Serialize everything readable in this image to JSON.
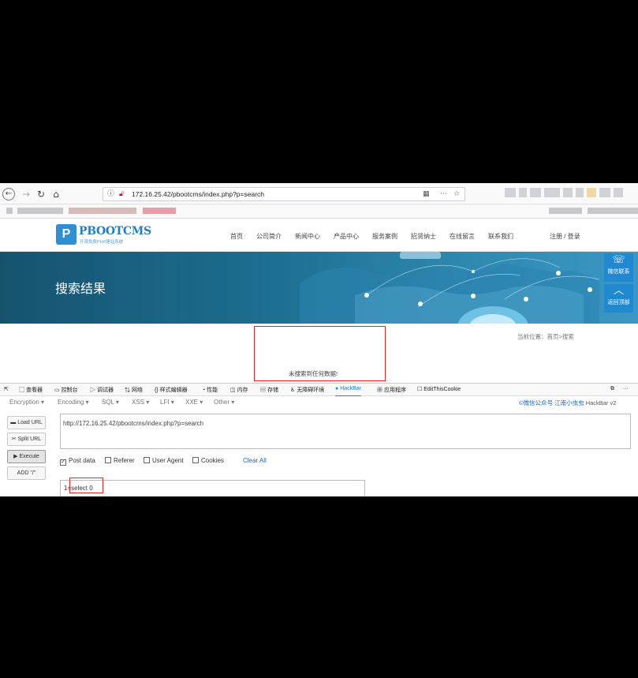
{
  "browser": {
    "url": "172.16.25.42/pbootcms/index.php?p=search",
    "nav_icons": [
      "back-icon",
      "forward-icon",
      "reload-icon",
      "home-icon"
    ]
  },
  "site": {
    "logo_mark": "P",
    "logo_text": "PBOOTCMS",
    "logo_sub": "开源免费PHP建站系统",
    "nav": [
      "首页",
      "公司简介",
      "新闻中心",
      "产品中心",
      "服务案例",
      "招贤纳士",
      "在线留言",
      "联系我们"
    ],
    "login": "注册 / 登录",
    "banner_title": "搜索结果",
    "side_wechat": "微信联系",
    "side_top": "返回顶部",
    "breadcrumb": "当前位置：首页>搜索",
    "no_result": "未搜索到任何数据!"
  },
  "devtools": {
    "tabs": [
      "查看器",
      "控制台",
      "调试器",
      "网络",
      "样式编辑器",
      "性能",
      "内存",
      "存储",
      "无障碍环境",
      "HackBar",
      "应用程序",
      "EditThisCookie"
    ],
    "active_tab": "HackBar"
  },
  "hackbar": {
    "menus": [
      "Encryption ▾",
      "Encoding ▾",
      "SQL ▾",
      "XSS ▾",
      "LFI ▾",
      "XXE ▾",
      "Other ▾"
    ],
    "credit_prefix": "©微信公众号",
    "credit_name": "江南小虫虫",
    "credit_suffix": "HackBar v2",
    "buttons": {
      "load": "Load URL",
      "split": "Split URL",
      "execute": "Execute",
      "add": "ADD \"/\""
    },
    "url_value": "http://172.16.25.42/pbootcms/index.php?p=search",
    "options": {
      "post": "Post data",
      "referer": "Referer",
      "user_agent": "User Agent",
      "cookies": "Cookies",
      "clear_all": "Clear All"
    },
    "post_value": "1=select 0"
  }
}
